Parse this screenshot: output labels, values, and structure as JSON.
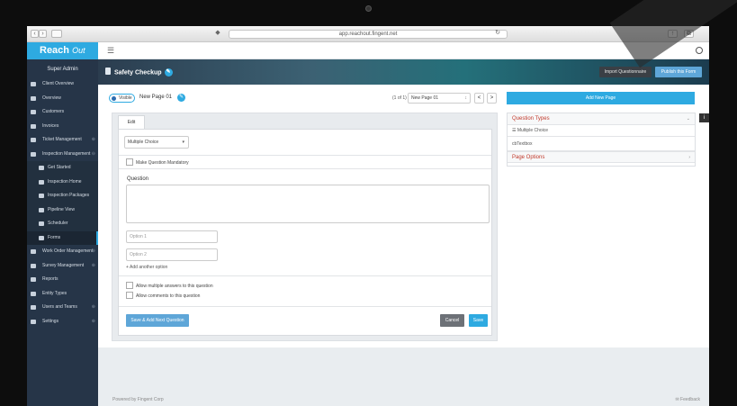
{
  "browser": {
    "url": "app.reachout.fingent.net"
  },
  "brand": {
    "name": "Reach",
    "suffix": "Out",
    "accent": "#2eaae1"
  },
  "sidebar": {
    "user": "Super Admin",
    "items": [
      {
        "label": "Client Overview"
      },
      {
        "label": "Overview"
      },
      {
        "label": "Customers"
      },
      {
        "label": "Invoices"
      },
      {
        "label": "Ticket Management"
      },
      {
        "label": "Inspection Management"
      },
      {
        "label": "Get Started"
      },
      {
        "label": "Inspection Home"
      },
      {
        "label": "Inspection Packages"
      },
      {
        "label": "Pipeline View"
      },
      {
        "label": "Scheduler"
      },
      {
        "label": "Forms"
      },
      {
        "label": "Work Order Management"
      },
      {
        "label": "Survey Management"
      },
      {
        "label": "Reports"
      },
      {
        "label": "Entity Types"
      },
      {
        "label": "Users and Teams"
      },
      {
        "label": "Settings"
      }
    ]
  },
  "header": {
    "title": "Safety Checkup",
    "import_label": "Import Questionnaire",
    "publish_label": "Publish this Form"
  },
  "page_bar": {
    "visible_label": "Visible",
    "page_name": "New Page 01",
    "pager_text": "(1 of 1)",
    "page_select": "New Page 01",
    "prev": "<",
    "next": ">",
    "add_page_label": "Add New Page"
  },
  "editor": {
    "tab_label": "Edit",
    "question_type": "Multiple Choice",
    "mandatory_label": "Make Question Mandatory",
    "question_label": "Question",
    "option1_placeholder": "Option 1",
    "option2_placeholder": "Option 2",
    "add_option_label": "+ Add another option",
    "allow_multiple_label": "Allow multiple answers to this question",
    "allow_comments_label": "Allow comments to this question",
    "save_next_label": "Save & Add Next Question",
    "cancel_label": "Cancel",
    "save_label": "Save"
  },
  "right_panel": {
    "question_types_label": "Question Types",
    "types": [
      "Multiple Choice",
      "cbTextbox"
    ],
    "page_options_label": "Page Options"
  },
  "footer": {
    "powered": "Powered by Fingent Corp",
    "feedback": "Feedback"
  }
}
